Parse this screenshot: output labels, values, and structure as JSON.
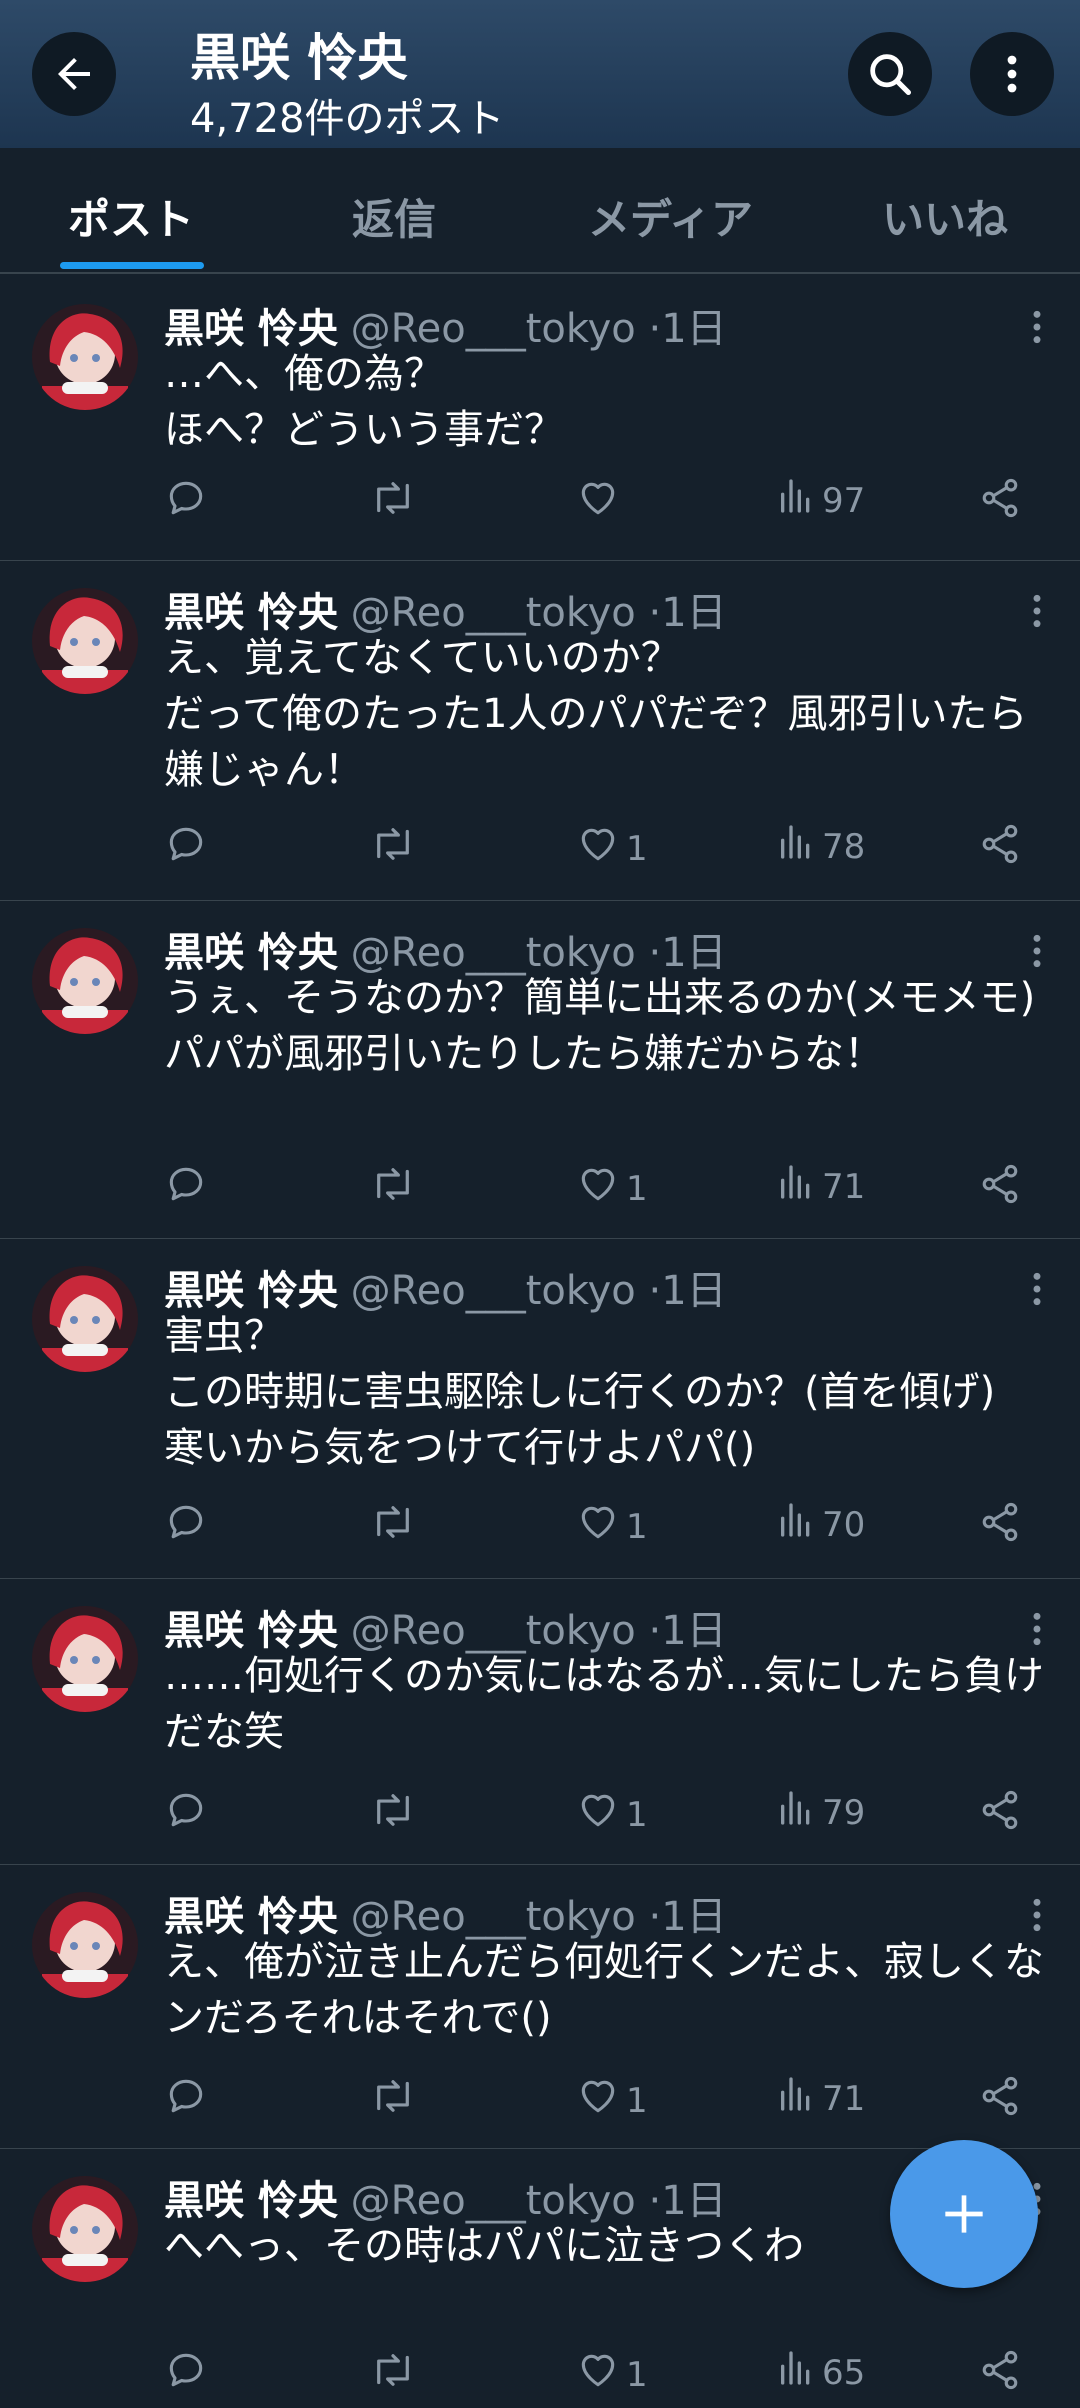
{
  "header": {
    "title": "黒咲 怜央",
    "post_count": "4,728件のポスト",
    "back_icon": "arrow-left-icon",
    "search_icon": "search-icon",
    "more_icon": "more-vertical-icon"
  },
  "tabs": [
    {
      "label": "ポスト",
      "active": true
    },
    {
      "label": "返信",
      "active": false
    },
    {
      "label": "メディア",
      "active": false
    },
    {
      "label": "いいね",
      "active": false
    }
  ],
  "colors": {
    "accent": "#1d9bf0",
    "background": "#15202b",
    "header": "#2e4a68",
    "fab": "#4a99e9"
  },
  "posts": [
    {
      "name": "黒咲 怜央",
      "handle": "@Reo___tokyo",
      "dot": "·",
      "time": "1日",
      "text": "…へ、俺の為？\nほへ？どういう事だ？",
      "likes": "",
      "views": "97"
    },
    {
      "name": "黒咲 怜央",
      "handle": "@Reo___tokyo",
      "dot": "·",
      "time": "1日",
      "text": "え、覚えてなくていいのか？\nだって俺のたった1人のパパだぞ？風邪引いたら嫌じゃん！",
      "likes": "1",
      "views": "78"
    },
    {
      "name": "黒咲 怜央",
      "handle": "@Reo___tokyo",
      "dot": "·",
      "time": "1日",
      "text": "うぇ、そうなのか？簡単に出来るのか(メモメモ)\nパパが風邪引いたりしたら嫌だからな！",
      "likes": "1",
      "views": "71"
    },
    {
      "name": "黒咲 怜央",
      "handle": "@Reo___tokyo",
      "dot": "·",
      "time": "1日",
      "text": "害虫？\nこの時期に害虫駆除しに行くのか？(首を傾げ)\n寒いから気をつけて行けよパパ()",
      "likes": "1",
      "views": "70"
    },
    {
      "name": "黒咲 怜央",
      "handle": "@Reo___tokyo",
      "dot": "·",
      "time": "1日",
      "text": "……何処行くのか気にはなるが…気にしたら負けだな笑",
      "likes": "1",
      "views": "79"
    },
    {
      "name": "黒咲 怜央",
      "handle": "@Reo___tokyo",
      "dot": "·",
      "time": "1日",
      "text": "え、俺が泣き止んだら何処行くンだよ、寂しくなンだろそれはそれで()",
      "likes": "1",
      "views": "71"
    },
    {
      "name": "黒咲 怜央",
      "handle": "@Reo___tokyo",
      "dot": "·",
      "time": "1日",
      "text": "へへっ、その時はパパに泣きつくわ",
      "likes": "1",
      "views": "65"
    }
  ],
  "fab": {
    "icon": "plus-icon"
  }
}
